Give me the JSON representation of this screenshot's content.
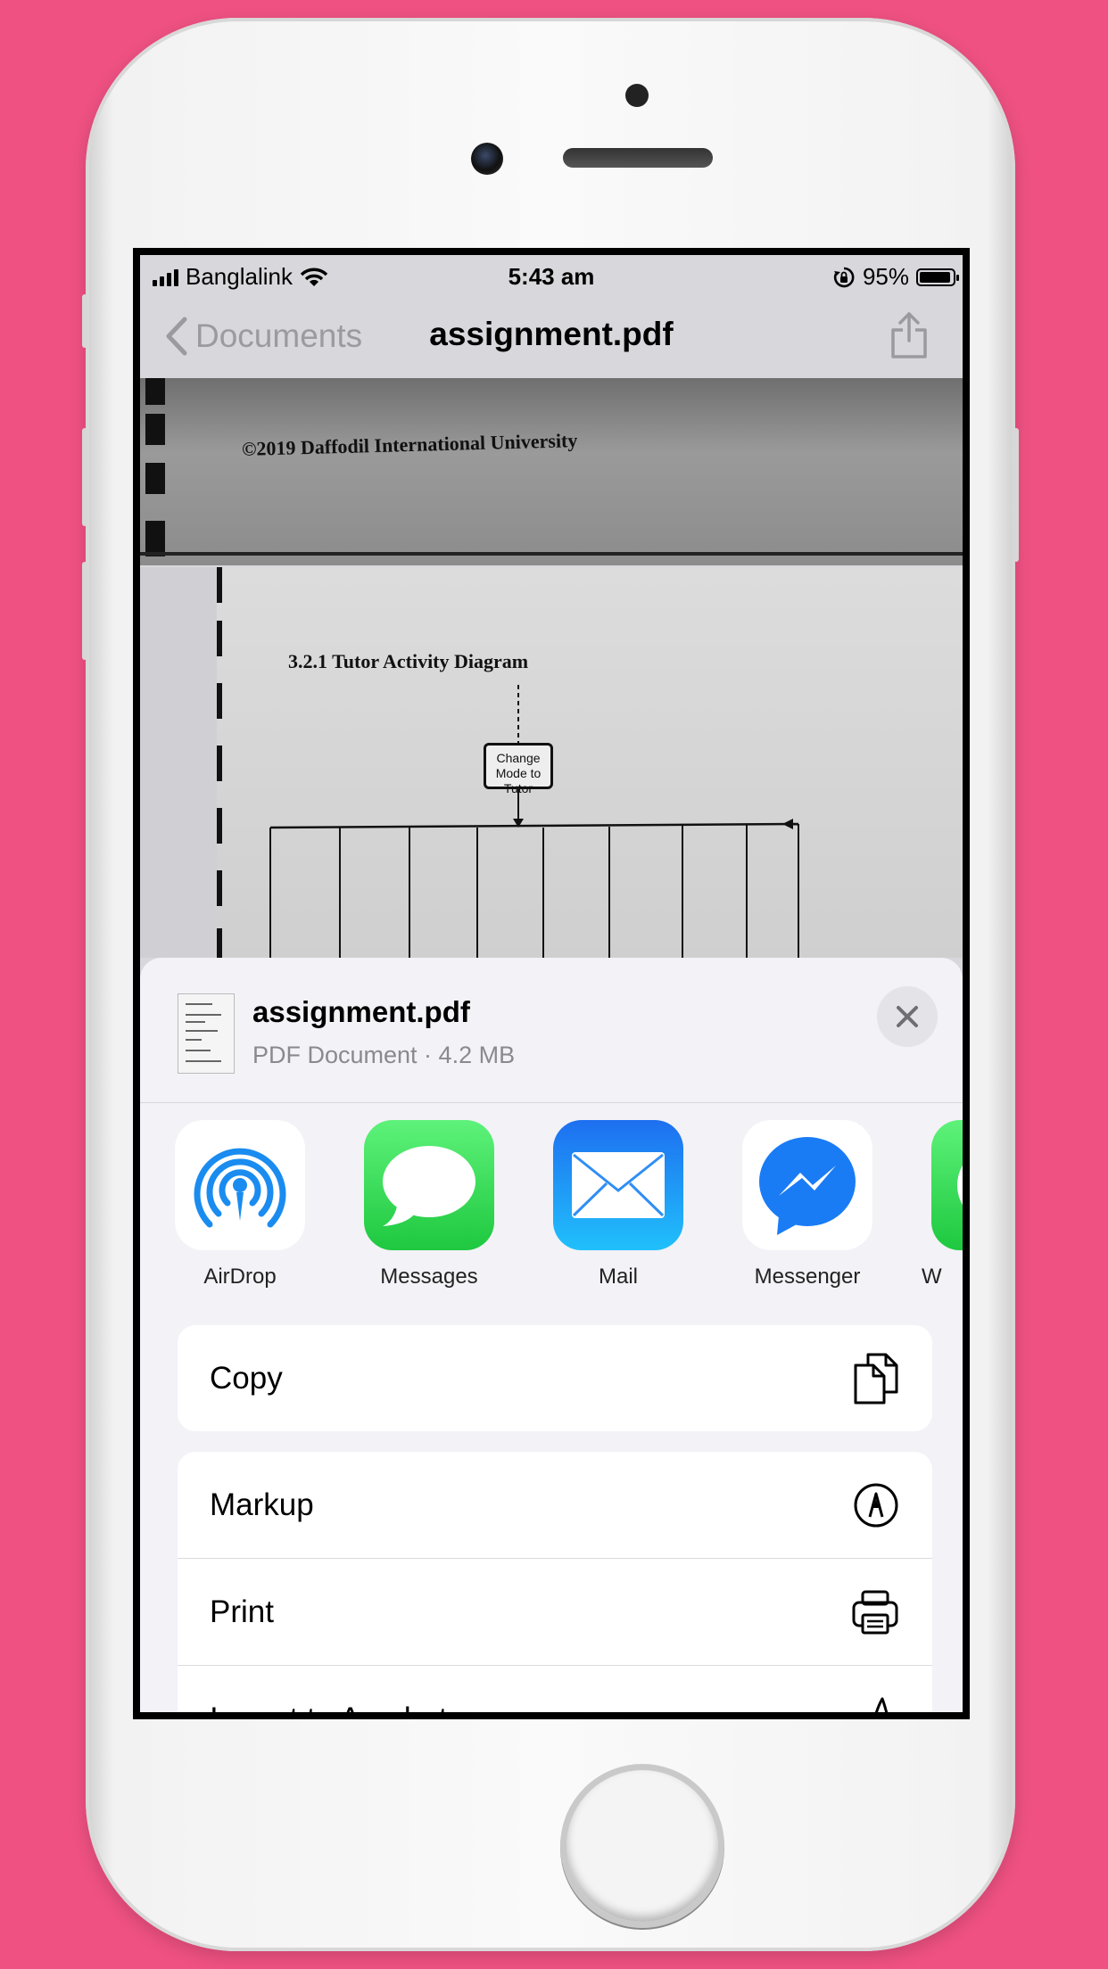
{
  "status_bar": {
    "carrier": "Banglalink",
    "time": "5:43 am",
    "battery_percent": "95%",
    "battery_level": 0.95
  },
  "nav": {
    "back_label": "Documents",
    "title": "assignment.pdf"
  },
  "document": {
    "page1_text": "©2019 Daffodil International University",
    "page2_heading": "3.2.1 Tutor Activity Diagram",
    "activity_box_text": "Change Mode to Tutor"
  },
  "share_sheet": {
    "file_name": "assignment.pdf",
    "file_meta": "PDF Document · 4.2 MB",
    "apps": [
      {
        "label": "AirDrop",
        "icon": "airdrop-icon"
      },
      {
        "label": "Messages",
        "icon": "messages-icon"
      },
      {
        "label": "Mail",
        "icon": "mail-icon"
      },
      {
        "label": "Messenger",
        "icon": "messenger-icon"
      },
      {
        "label": "W",
        "icon": "whatsapp-icon"
      }
    ],
    "actions_group1": [
      {
        "label": "Copy",
        "icon": "copy-icon"
      }
    ],
    "actions_group2": [
      {
        "label": "Markup",
        "icon": "markup-icon"
      },
      {
        "label": "Print",
        "icon": "print-icon"
      },
      {
        "label": "Import to Acrobat",
        "icon": "acrobat-icon"
      }
    ]
  },
  "colors": {
    "background": "#ee5182",
    "messages_green": "#34c759",
    "mail_blue": "#1e8bf6",
    "messenger_blue": "#1877f2",
    "airdrop_blue": "#1a8cf0"
  }
}
